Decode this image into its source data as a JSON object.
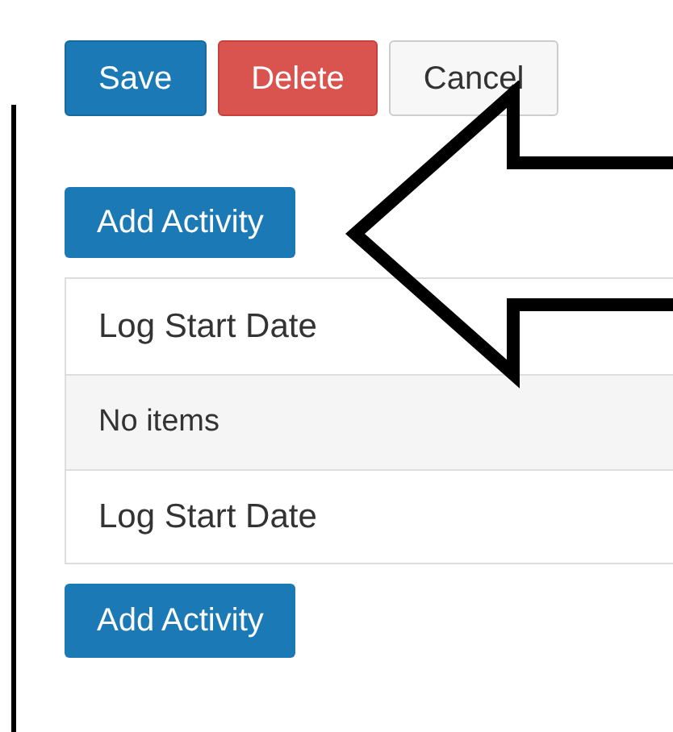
{
  "actions": [
    {
      "label": "Save",
      "kind": "primary"
    },
    {
      "label": "Delete",
      "kind": "danger"
    },
    {
      "label": "Cancel",
      "kind": "default"
    }
  ],
  "add_button_top": "Add Activity",
  "table": {
    "header": "Log Start Date",
    "empty_message": "No items",
    "footer": "Log Start Date"
  },
  "add_button_bottom": "Add Activity"
}
